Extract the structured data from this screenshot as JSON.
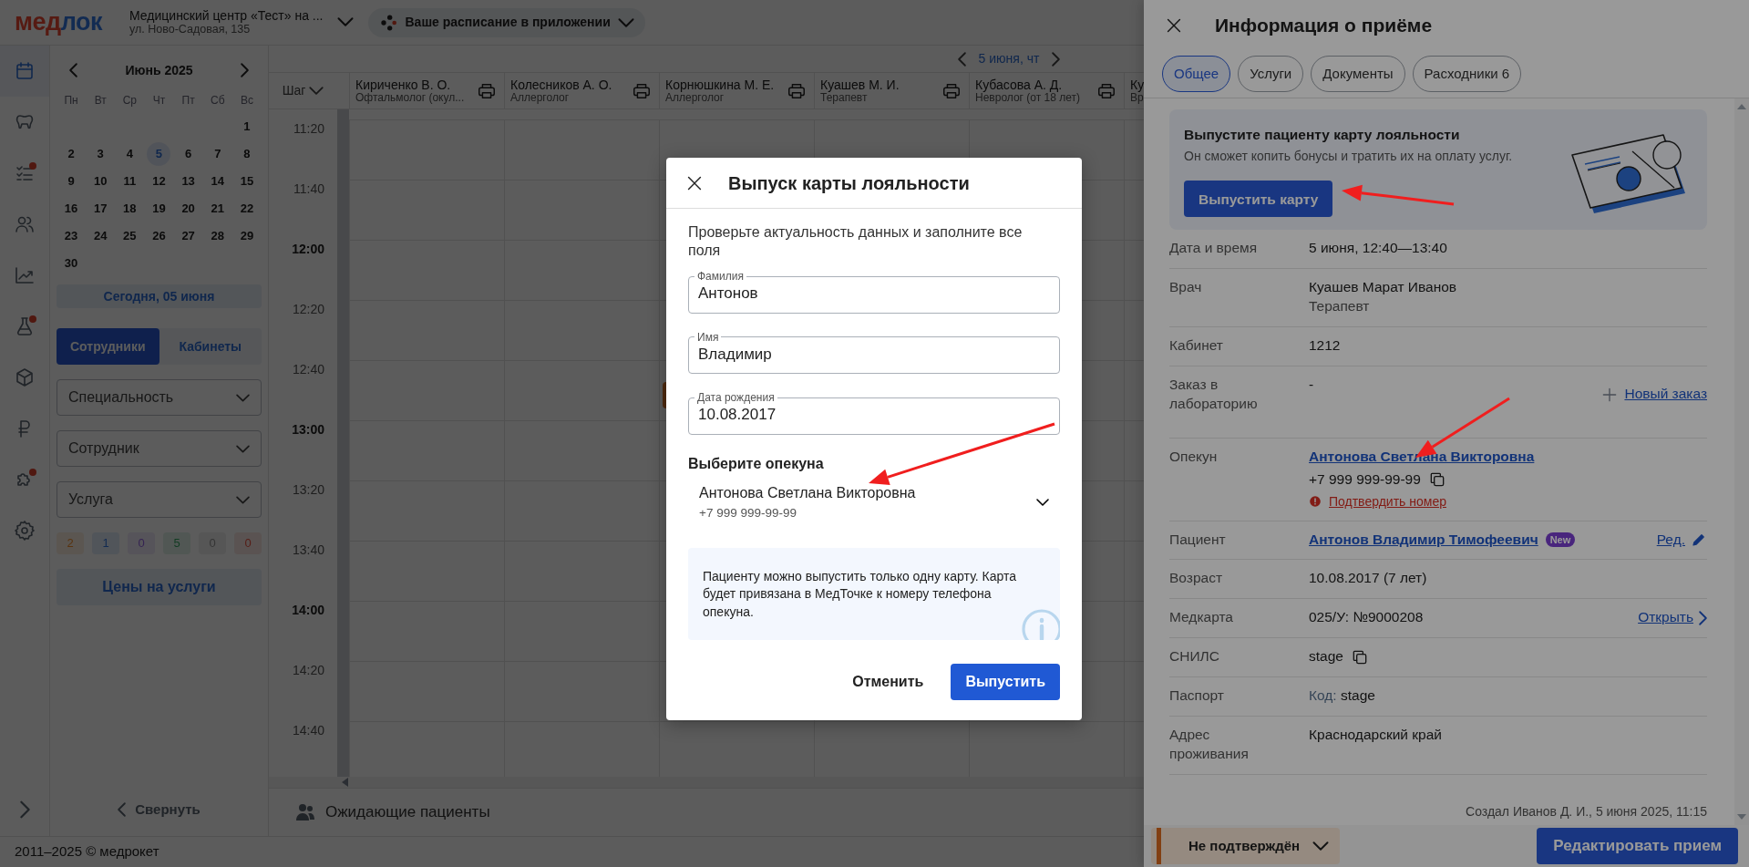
{
  "header": {
    "logo": [
      {
        "text": "мед",
        "color": "#561a12"
      },
      {
        "text": "лок",
        "color": "#122b52"
      }
    ],
    "clinic_name": "Медицинский центр «Тест» на ...",
    "clinic_address": "ул. Ново-Садовая, 135",
    "app_pill": "Ваше расписание в приложении"
  },
  "nav_rail": [
    {
      "kind": "calendar",
      "selected": true,
      "alert": false
    },
    {
      "kind": "tooth",
      "selected": false,
      "alert": false
    },
    {
      "kind": "checklist",
      "selected": false,
      "alert": true
    },
    {
      "kind": "users",
      "selected": false,
      "alert": false
    },
    {
      "kind": "chart",
      "selected": false,
      "alert": false
    },
    {
      "kind": "flask",
      "selected": false,
      "alert": true
    },
    {
      "kind": "box",
      "selected": false,
      "alert": false
    },
    {
      "kind": "ruble",
      "selected": false,
      "alert": false
    },
    {
      "kind": "puzzle",
      "selected": false,
      "alert": true
    },
    {
      "kind": "gear",
      "selected": false,
      "alert": false
    }
  ],
  "calendar": {
    "month": "Июнь 2025",
    "weekdays": [
      "Пн",
      "Вт",
      "Ср",
      "Чт",
      "Пт",
      "Сб",
      "Вс"
    ],
    "weeks": [
      [
        {
          "day": "1",
          "today": false
        }
      ],
      [
        {
          "day": "2",
          "today": false
        },
        {
          "day": "3",
          "today": false
        },
        {
          "day": "4",
          "today": false
        },
        {
          "day": "5",
          "today": true
        },
        {
          "day": "6",
          "today": false
        },
        {
          "day": "7",
          "today": false
        },
        {
          "day": "8",
          "today": false
        }
      ],
      [
        {
          "day": "9",
          "today": false
        },
        {
          "day": "10",
          "today": false
        },
        {
          "day": "11",
          "today": false
        },
        {
          "day": "12",
          "today": false
        },
        {
          "day": "13",
          "today": false
        },
        {
          "day": "14",
          "today": false
        },
        {
          "day": "15",
          "today": false
        }
      ],
      [
        {
          "day": "16",
          "today": false
        },
        {
          "day": "17",
          "today": false
        },
        {
          "day": "18",
          "today": false
        },
        {
          "day": "19",
          "today": false
        },
        {
          "day": "20",
          "today": false
        },
        {
          "day": "21",
          "today": false
        },
        {
          "day": "22",
          "today": false
        }
      ],
      [
        {
          "day": "23",
          "today": false
        },
        {
          "day": "24",
          "today": false
        },
        {
          "day": "25",
          "today": false
        },
        {
          "day": "26",
          "today": false
        },
        {
          "day": "27",
          "today": false
        },
        {
          "day": "28",
          "today": false
        },
        {
          "day": "29",
          "today": false
        }
      ],
      [
        {
          "day": "30",
          "today": false
        }
      ]
    ]
  },
  "today_button": "Сегодня, 05 июня",
  "view_tabs": [
    {
      "label": "Сотрудники",
      "selected": true
    },
    {
      "label": "Кабинеты",
      "selected": false
    }
  ],
  "filters": [
    {
      "placeholder": "Специальность"
    },
    {
      "placeholder": "Сотрудник"
    },
    {
      "placeholder": "Услуга"
    }
  ],
  "counters": [
    {
      "value": "2",
      "color": "#593410"
    },
    {
      "value": "1",
      "color": "#122b52"
    },
    {
      "value": "0",
      "color": "#352352"
    },
    {
      "value": "5",
      "color": "#123c23"
    },
    {
      "value": "0",
      "color": "#353535"
    },
    {
      "value": "0",
      "color": "#561d16"
    }
  ],
  "prices_button": "Цены на услуги",
  "collapse": "Свернуть",
  "footer": "2011–2025 © медрокет",
  "schedule": {
    "date": "5 июня, чт",
    "step": "Шаг",
    "columns": [
      {
        "name": "Кириченко В. О.",
        "specialty": "Офтальмолог (окул..."
      },
      {
        "name": "Колесников А. О.",
        "specialty": "Аллерголог"
      },
      {
        "name": "Корнюшкина М. Е.",
        "specialty": "Аллерголог"
      },
      {
        "name": "Куашев М. И.",
        "specialty": "Терапевт"
      },
      {
        "name": "Кубасова А. Д.",
        "specialty": "Невролог (от 18 лет)"
      },
      {
        "name": "Ку",
        "specialty": "Вр"
      }
    ],
    "times": [
      {
        "label": "11:20",
        "hour": false
      },
      {
        "label": "11:40",
        "hour": false
      },
      {
        "label": "12:00",
        "hour": true
      },
      {
        "label": "12:20",
        "hour": false
      },
      {
        "label": "12:40",
        "hour": false
      },
      {
        "label": "13:00",
        "hour": true
      },
      {
        "label": "13:20",
        "hour": false
      },
      {
        "label": "13:40",
        "hour": false
      },
      {
        "label": "14:00",
        "hour": true
      },
      {
        "label": "14:20",
        "hour": false
      },
      {
        "label": "14:40",
        "hour": false
      }
    ],
    "waiting": "Ожидающие пациенты"
  },
  "panel": {
    "title": "Информация о приёме",
    "tabs": [
      {
        "label": "Общее",
        "selected": true
      },
      {
        "label": "Услуги",
        "selected": false
      },
      {
        "label": "Документы",
        "selected": false
      },
      {
        "label": "Расходники 6",
        "selected": false
      }
    ],
    "promo": {
      "title": "Выпустите пациенту карту лояльности",
      "text": "Он сможет копить бонусы и тратить их на оплату услуг.",
      "button": "Выпустить карту"
    },
    "rows": [
      {
        "kind": "text",
        "label": "Дата и время",
        "value": "5 июня, 12:40—13:40"
      },
      {
        "kind": "text",
        "label": "Врач",
        "value": "Куашев Марат Иванов",
        "sub": "Терапевт"
      },
      {
        "kind": "text",
        "label": "Кабинет",
        "value": "1212"
      },
      {
        "kind": "order",
        "label": "Заказ в лабораторию",
        "value": "-",
        "action": "Новый заказ"
      },
      {
        "kind": "guardian",
        "label": "Опекун",
        "link": "Антонова Светлана Викторовна",
        "phone": "+7 999 999-99-99",
        "warning": "Подтвердить номер"
      },
      {
        "kind": "patient",
        "label": "Пациент",
        "link": "Антонов Владимир Тимофеевич",
        "badge": "New",
        "action": "Ред."
      },
      {
        "kind": "text",
        "label": "Возраст",
        "value": "10.08.2017 (7 лет)"
      },
      {
        "kind": "record",
        "label": "Медкарта",
        "value": "025/У: №9000208",
        "action": "Открыть"
      },
      {
        "kind": "text",
        "label": "СНИЛС",
        "value": "stage",
        "copyable": true
      },
      {
        "kind": "text",
        "label": "Паспорт",
        "prefix": "Код:",
        "value": "stage"
      },
      {
        "kind": "text",
        "label": "Адрес проживания",
        "value": "Краснодарский край"
      }
    ],
    "created": "Создал Иванов Д. И., 5 июня 2025, 11:15",
    "status": {
      "label": "Не подтверждён",
      "color": "#823f12"
    },
    "edit_button": "Редактировать прием"
  },
  "modal": {
    "title": "Выпуск карты лояльности",
    "intro": "Проверьте актуальность данных и заполните все поля",
    "fields": [
      {
        "label": "Фамилия",
        "value": "Антонов"
      },
      {
        "label": "Имя",
        "value": "Владимир"
      },
      {
        "label": "Дата рождения",
        "value": "10.08.2017"
      }
    ],
    "guardian_label": "Выберите опекуна",
    "guardian": {
      "name": "Антонова Светлана Викторовна",
      "phone": "+7 999 999-99-99"
    },
    "notice": "Пациенту можно выпустить только одну карту. Карта будет привязана в МедТочке к номеру телефона опекуна.",
    "cancel": "Отменить",
    "submit": "Выпустить"
  }
}
